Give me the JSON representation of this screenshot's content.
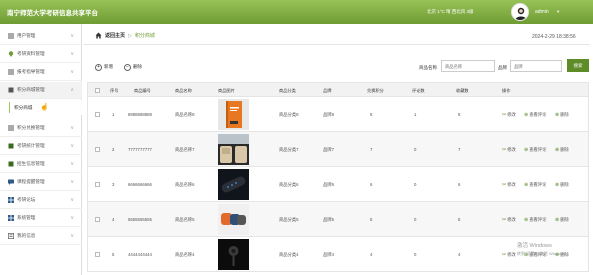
{
  "header": {
    "title": "南宁师范大学考研信息共享平台",
    "weather": "北京 1°C 晴 西北风 3级",
    "user": "admin",
    "caret": "▾"
  },
  "sidebar": {
    "items": [
      {
        "label": "用户管理",
        "icon": "users-icon"
      },
      {
        "label": "考研资料管理",
        "icon": "location-icon"
      },
      {
        "label": "报考指导管理",
        "icon": "list-icon"
      },
      {
        "label": "积分商城管理",
        "icon": "book-icon"
      },
      {
        "label": "积分兑换管理",
        "icon": "list-icon"
      },
      {
        "label": "考研统计管理",
        "icon": "book-icon"
      },
      {
        "label": "招生信息管理",
        "icon": "book-icon"
      },
      {
        "label": "课程提醒管理",
        "icon": "chat-icon"
      },
      {
        "label": "考研论坛",
        "icon": "grid-icon"
      },
      {
        "label": "系统管理",
        "icon": "grid-icon"
      },
      {
        "label": "我的信息",
        "icon": "profile-icon"
      }
    ],
    "submenu_label": "积分商城",
    "arrow": "∨"
  },
  "breadcrumb": {
    "home": "返回主页",
    "separator": "▷",
    "current": "积分商城"
  },
  "datetime": "2024-2-29 18:38:56",
  "toolbar": {
    "add_label": "新增",
    "add_icon": "+",
    "delete_label": "删除",
    "delete_icon": "−"
  },
  "search": {
    "name_label": "商品名称",
    "name_placeholder": "商品名称",
    "brand_label": "品牌",
    "brand_placeholder": "品牌",
    "button_label": "搜索"
  },
  "table": {
    "columns": [
      "序号",
      "商品编号",
      "商品名称",
      "商品图片",
      "商品分类",
      "品牌",
      "兑换积分",
      "评论数",
      "收藏数",
      "操作"
    ],
    "rows": [
      {
        "seq": "1",
        "code": "8888888888",
        "name": "商品名称8",
        "category": "商品分类8",
        "brand": "品牌8",
        "points": "8",
        "comments": "1",
        "favorites": "8",
        "image": "book-image"
      },
      {
        "seq": "2",
        "code": "7777777777",
        "name": "商品名称7",
        "category": "商品分类7",
        "brand": "品牌7",
        "points": "7",
        "comments": "0",
        "favorites": "7",
        "image": "car-interior-image"
      },
      {
        "seq": "3",
        "code": "6666666666",
        "name": "商品名称6",
        "category": "商品分类6",
        "brand": "品牌6",
        "points": "6",
        "comments": "0",
        "favorites": "6",
        "image": "remote-image"
      },
      {
        "seq": "4",
        "code": "5555555555",
        "name": "商品名称5",
        "category": "商品分类5",
        "brand": "品牌5",
        "points": "5",
        "comments": "0",
        "favorites": "5",
        "image": "speakers-image"
      },
      {
        "seq": "5",
        "code": "4444444444",
        "name": "商品名称4",
        "category": "商品分类4",
        "brand": "品牌4",
        "points": "4",
        "comments": "0",
        "favorites": "4",
        "image": "earbuds-image"
      }
    ],
    "actions": {
      "edit": "修改",
      "edit_icon": "✂",
      "review": "查看评论",
      "review_icon": "⊕",
      "delete": "删除",
      "delete_icon": "⊗"
    }
  },
  "watermark": {
    "line1": "激活 Windows",
    "line2": "转到\"设置\"以激活 Windows。"
  },
  "colors": {
    "header_top": "#97c257",
    "header_bottom": "#6f9c33",
    "accent": "#5d8c28"
  }
}
